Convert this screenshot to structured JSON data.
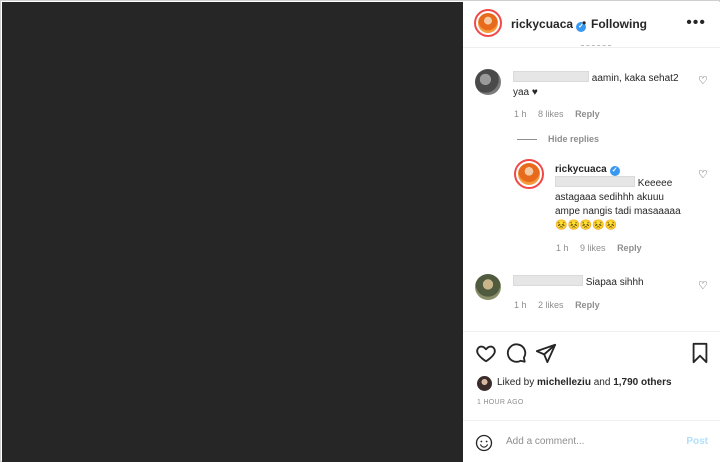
{
  "header": {
    "username": "rickycuaca",
    "separator": "•",
    "follow_status": "Following",
    "more": "•••"
  },
  "comments": [
    {
      "text_line1": "aamin, kaka sehat2",
      "text_line2": "yaa",
      "time": "1 h",
      "likes": "8 likes",
      "reply_label": "Reply"
    },
    {
      "text": "Siapaa sihhh",
      "time": "1 h",
      "likes": "2 likes",
      "reply_label": "Reply"
    }
  ],
  "hide_replies": "Hide replies",
  "reply": {
    "username": "rickycuaca",
    "text_line1": "Keeeee",
    "text_line2": "astagaaa sedihhh akuuu",
    "text_line3": "ampe nangis tadi masaaaaa",
    "emojis": "😣😣😣😣😣",
    "time": "1 h",
    "likes": "9 likes",
    "reply_label": "Reply"
  },
  "actions": {
    "liked_prefix": "Liked by ",
    "liked_user": "michelleziu",
    "liked_mid": " and ",
    "liked_count": "1,790 others",
    "timestamp": "1 HOUR AGO"
  },
  "add_comment": {
    "placeholder": "Add a comment...",
    "post_label": "Post"
  },
  "colors": {
    "media_bg": "#262626",
    "accent_blue": "#3897f0",
    "post_disabled": "#b2dffc",
    "muted": "#8e8e8e"
  }
}
